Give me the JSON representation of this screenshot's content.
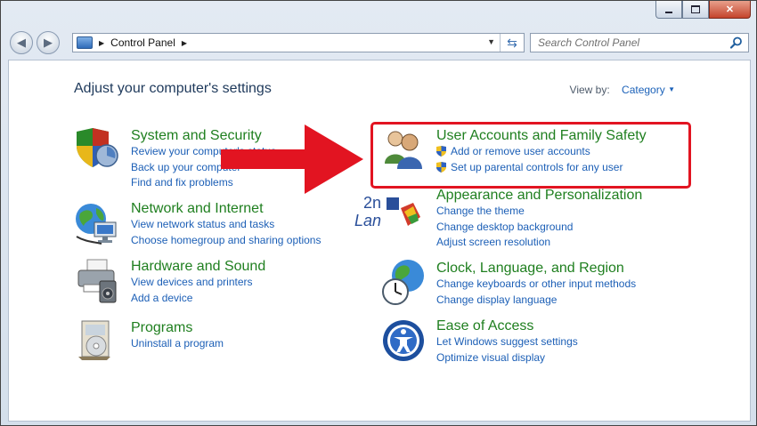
{
  "titlebar": {
    "minimize_icon": "minimize-icon",
    "maximize_icon": "maximize-icon",
    "close_icon": "close-icon"
  },
  "address": {
    "crumb": "Control Panel"
  },
  "search": {
    "placeholder": "Search Control Panel"
  },
  "heading": "Adjust your computer's settings",
  "view_by": {
    "label": "View by:",
    "value": "Category"
  },
  "categories": [
    {
      "title": "System and Security",
      "links": [
        "Review your computer's status",
        "Back up your computer",
        "Find and fix problems"
      ]
    },
    {
      "title": "Network and Internet",
      "links": [
        "View network status and tasks",
        "Choose homegroup and sharing options"
      ]
    },
    {
      "title": "Hardware and Sound",
      "links": [
        "View devices and printers",
        "Add a device"
      ]
    },
    {
      "title": "Programs",
      "links": [
        "Uninstall a program"
      ]
    },
    {
      "title": "User Accounts and Family Safety",
      "links": [
        "Add or remove user accounts",
        "Set up parental controls for any user"
      ]
    },
    {
      "title": "Appearance and Personalization",
      "links": [
        "Change the theme",
        "Change desktop background",
        "Adjust screen resolution"
      ]
    },
    {
      "title": "Clock, Language, and Region",
      "links": [
        "Change keyboards or other input methods",
        "Change display language"
      ]
    },
    {
      "title": "Ease of Access",
      "links": [
        "Let Windows suggest settings",
        "Optimize visual display"
      ]
    }
  ],
  "annotation": {
    "highlight_color": "#e21421"
  },
  "watermark": {
    "text": "2nd Land"
  }
}
